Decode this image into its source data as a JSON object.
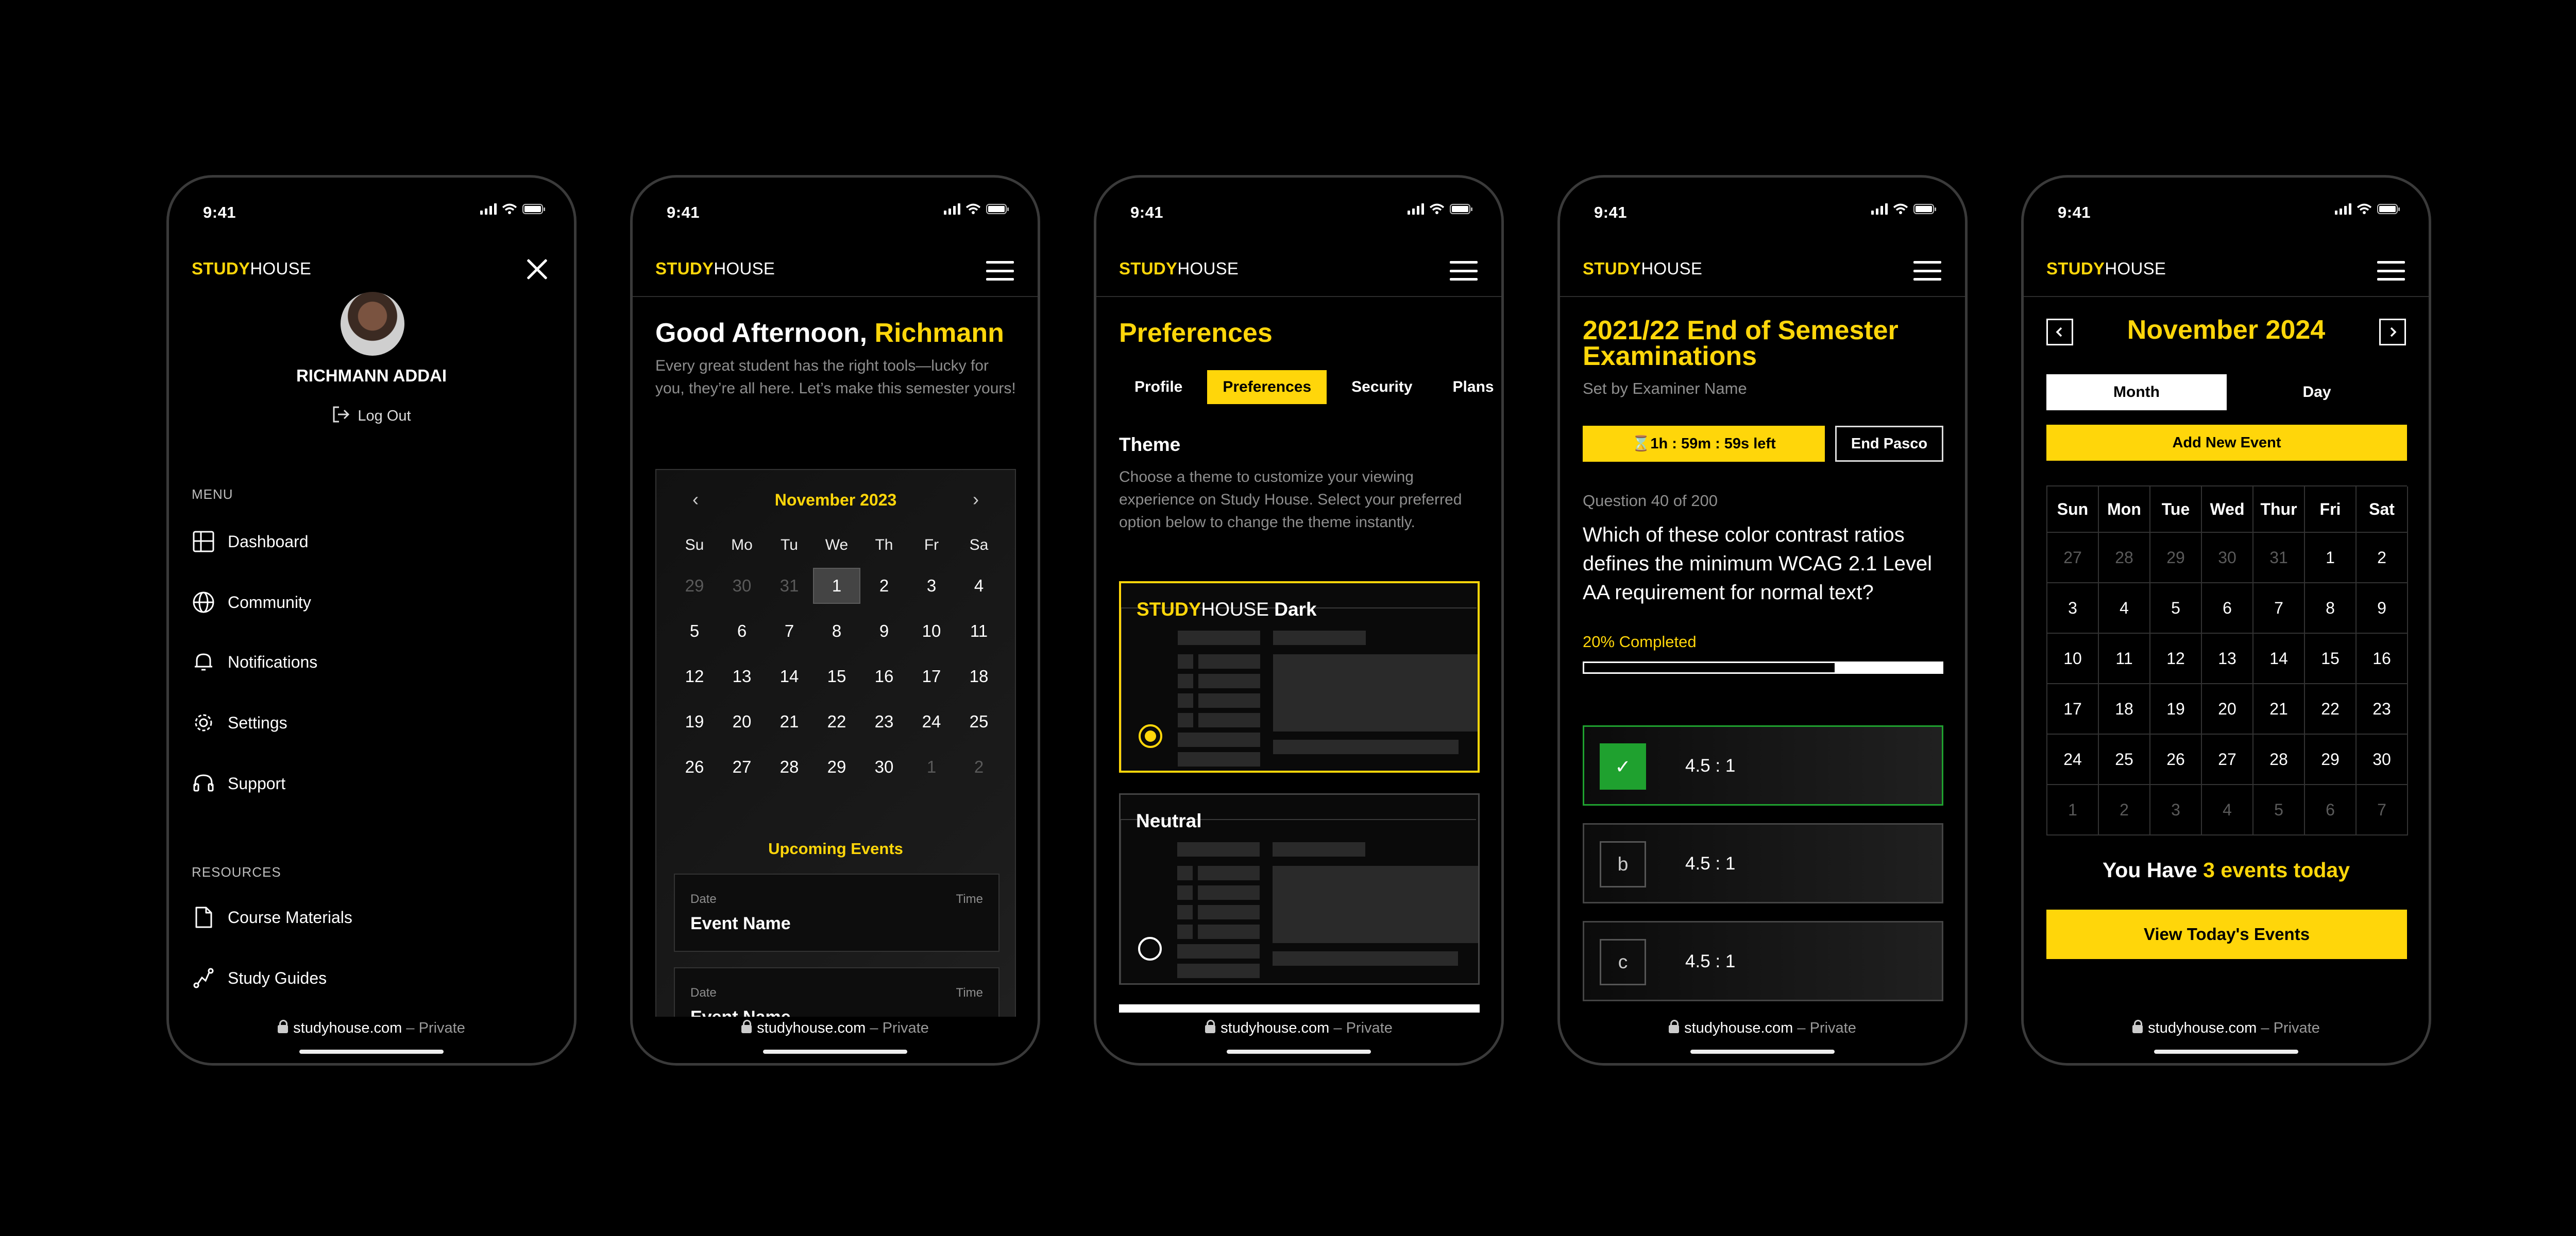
{
  "status": {
    "time": "9:41"
  },
  "brand": {
    "part1": "STUDY",
    "part2": "HOUSE"
  },
  "footer": {
    "domain": "studyhouse.com",
    "suffix": " – Private"
  },
  "menu_screen": {
    "user_name": "RICHMANN ADDAI",
    "logout": "Log Out",
    "menu_heading": "MENU",
    "menu_items": [
      "Dashboard",
      "Community",
      "Notifications",
      "Settings",
      "Support"
    ],
    "resources_heading": "RESOURCES",
    "resource_items": [
      "Course Materials",
      "Study Guides"
    ]
  },
  "dashboard_screen": {
    "greeting": "Good Afternoon, ",
    "name": "Richmann",
    "subtitle": "Every great student has the right tools—lucky for you, they’re all here. Let’s make this semester yours!",
    "calendar": {
      "month": "November 2023",
      "weekdays": [
        "Su",
        "Mo",
        "Tu",
        "We",
        "Th",
        "Fr",
        "Sa"
      ],
      "days": [
        "29",
        "30",
        "31",
        "1",
        "2",
        "3",
        "4",
        "5",
        "6",
        "7",
        "8",
        "9",
        "10",
        "11",
        "12",
        "13",
        "14",
        "15",
        "16",
        "17",
        "18",
        "19",
        "20",
        "21",
        "22",
        "23",
        "24",
        "25",
        "26",
        "27",
        "28",
        "29",
        "30",
        "1",
        "2"
      ],
      "selected": "1"
    },
    "upcoming_title": "Upcoming Events",
    "events": [
      {
        "date_label": "Date",
        "time_label": "Time",
        "name": "Event Name"
      },
      {
        "date_label": "Date",
        "time_label": "Time",
        "name": "Event Name"
      }
    ]
  },
  "preferences_screen": {
    "title": "Preferences",
    "tabs": [
      "Profile",
      "Preferences",
      "Security",
      "Plans"
    ],
    "active_tab": "Preferences",
    "theme_heading": "Theme",
    "theme_desc": "Choose a theme to customize your viewing experience on Study House. Select your preferred option below to change the theme instantly.",
    "themes": [
      {
        "brand1": "STUDY",
        "brand2": "HOUSE",
        "label": " Dark",
        "selected": true
      },
      {
        "label": "Neutral",
        "selected": false
      }
    ]
  },
  "exam_screen": {
    "title": "2021/22 End of Semester Examinations",
    "subtitle": "Set by Examiner Name",
    "timer": "⌛1h : 59m : 59s  left",
    "end_button": "End Pasco",
    "question_no": "Question 40 of 200",
    "question": "Which of these color contrast ratios defines the minimum WCAG 2.1 Level AA requirement for normal text?",
    "progress_label": "20% Completed",
    "progress": 0.7,
    "options": [
      {
        "marker": "✓",
        "text": "4.5 : 1",
        "state": "correct"
      },
      {
        "marker": "b",
        "text": "4.5 : 1",
        "state": "default"
      },
      {
        "marker": "c",
        "text": "4.5 : 1",
        "state": "default"
      }
    ]
  },
  "calendar_screen": {
    "month": "November 2024",
    "views": [
      "Month",
      "Day"
    ],
    "active_view": "Month",
    "add_button": "Add New Event",
    "weekdays": [
      "Sun",
      "Mon",
      "Tue",
      "Wed",
      "Thur",
      "Fri",
      "Sat"
    ],
    "days": [
      "27",
      "28",
      "29",
      "30",
      "31",
      "1",
      "2",
      "3",
      "4",
      "5",
      "6",
      "7",
      "8",
      "9",
      "10",
      "11",
      "12",
      "13",
      "14",
      "15",
      "16",
      "17",
      "18",
      "19",
      "20",
      "21",
      "22",
      "23",
      "24",
      "25",
      "26",
      "27",
      "28",
      "29",
      "30",
      "1",
      "2",
      "3",
      "4",
      "5",
      "6",
      "7"
    ],
    "events_prefix": "You Have ",
    "events_count": "3 events today",
    "view_button": "View Today's Events"
  },
  "colors": {
    "accent": "#ffd60a",
    "success": "#1fa12f",
    "background": "#000000"
  }
}
